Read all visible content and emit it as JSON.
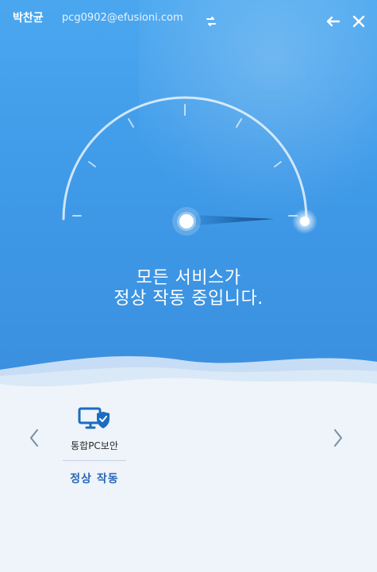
{
  "header": {
    "user_name": "박찬균",
    "user_email": "pcg0902@efusioni.com"
  },
  "icons": {
    "sync": "sync-icon",
    "back": "back-arrow-icon",
    "close": "close-icon",
    "left_nav": "chevron-left-icon",
    "right_nav": "chevron-right-icon",
    "service": "monitor-shield-icon"
  },
  "main": {
    "status_line1": "모든 서비스가",
    "status_line2": "정상 작동 중입니다."
  },
  "services": [
    {
      "label": "통합PC보안",
      "status": "정상 작동"
    }
  ],
  "colors": {
    "top_gradient_start": "#4aa7ef",
    "top_gradient_end": "#3a8fde",
    "status_text": "#2a66b7"
  }
}
